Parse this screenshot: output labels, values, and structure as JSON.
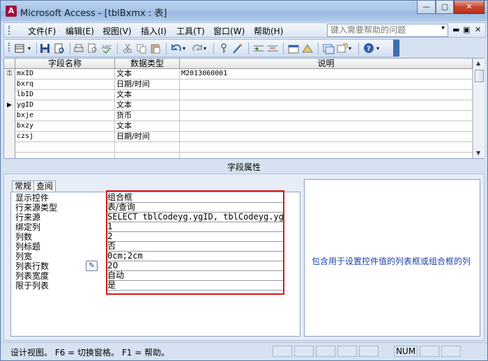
{
  "window": {
    "title": "Microsoft Access - [tblBxmx : 表]",
    "app_icon_glyph": "A",
    "minimize_glyph": "—",
    "maximize_glyph": "▢",
    "close_glyph": "✕"
  },
  "menubar": {
    "items": [
      "文件(F)",
      "编辑(E)",
      "视图(V)",
      "插入(I)",
      "工具(T)",
      "窗口(W)",
      "帮助(H)"
    ],
    "help_placeholder": "键入需要帮助的问题",
    "help_arrow": "▾",
    "doc_minimize": "▬",
    "doc_restore": "▣",
    "doc_close": "✕"
  },
  "toolbar": {
    "icons": [
      "view-icon",
      "save-icon",
      "print-preview-icon",
      "print-icon",
      "spell-check-icon",
      "cut-icon",
      "copy-icon",
      "paste-icon",
      "undo-icon",
      "redo-icon",
      "primary-key-icon",
      "builder-icon",
      "insert-row-icon",
      "delete-row-icon",
      "properties-icon",
      "indexes-icon",
      "database-window-icon",
      "new-object-icon",
      "help-icon"
    ]
  },
  "table_design": {
    "headers": [
      "字段名称",
      "数据类型",
      "说明"
    ],
    "rows": [
      {
        "selector": "key",
        "name": "mxID",
        "type": "文本",
        "desc": "M2013060001"
      },
      {
        "selector": "",
        "name": "bxrq",
        "type": "日期/时间",
        "desc": ""
      },
      {
        "selector": "",
        "name": "lbID",
        "type": "文本",
        "desc": ""
      },
      {
        "selector": "current",
        "name": "ygID",
        "type": "文本",
        "desc": ""
      },
      {
        "selector": "",
        "name": "bxje",
        "type": "货币",
        "desc": ""
      },
      {
        "selector": "",
        "name": "bxzy",
        "type": "文本",
        "desc": ""
      },
      {
        "selector": "",
        "name": "czsj",
        "type": "日期/时间",
        "desc": ""
      },
      {
        "selector": "",
        "name": "",
        "type": "",
        "desc": ""
      },
      {
        "selector": "",
        "name": "",
        "type": "",
        "desc": ""
      }
    ],
    "key_glyph": "⚿",
    "current_glyph": "▶"
  },
  "properties": {
    "section_title": "字段属性",
    "tabs": [
      "常规",
      "查阅"
    ],
    "active_tab": "查阅",
    "rows": [
      {
        "label": "显示控件",
        "value": "组合框"
      },
      {
        "label": "行来源类型",
        "value": "表/查询"
      },
      {
        "label": "行来源",
        "value": "SELECT tblCodeyg.ygID, tblCodeyg.ygxm FRC"
      },
      {
        "label": "绑定列",
        "value": "1"
      },
      {
        "label": "列数",
        "value": "2"
      },
      {
        "label": "列标题",
        "value": "否"
      },
      {
        "label": "列宽",
        "value": "0cm;2cm"
      },
      {
        "label": "列表行数",
        "value": "20"
      },
      {
        "label": "列表宽度",
        "value": "自动"
      },
      {
        "label": "限于列表",
        "value": "是"
      }
    ],
    "help_text": "包含用于设置控件值的列表框或组合框的列"
  },
  "status": {
    "text": "设计视图。 F6 = 切换窗格。 F1 = 帮助。",
    "num": "NUM"
  },
  "colors": {
    "highlight_border": "#d01c1c",
    "help_text": "#1c3fa8"
  }
}
